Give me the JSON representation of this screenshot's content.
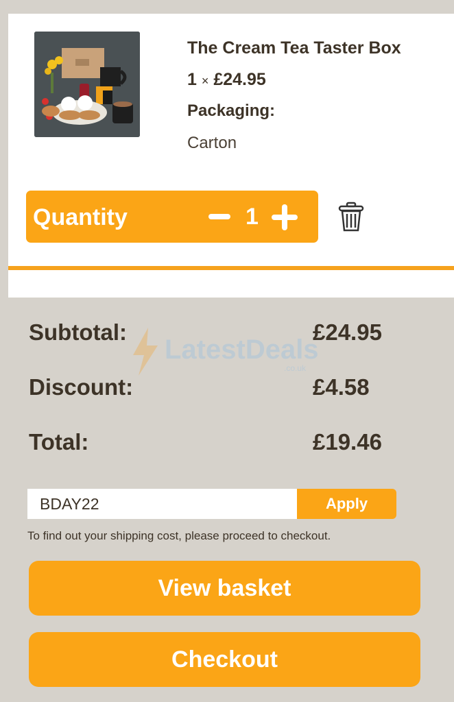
{
  "product": {
    "title": "The Cream Tea Taster Box",
    "quantity_prefix": "1",
    "multiply_sign": "×",
    "unit_price": "£24.95",
    "packaging_label": "Packaging:",
    "packaging_value": "Carton"
  },
  "quantity": {
    "label": "Quantity",
    "value": "1"
  },
  "summary": {
    "subtotal_label": "Subtotal:",
    "subtotal_value": "£24.95",
    "discount_label": "Discount:",
    "discount_value": "£4.58",
    "total_label": "Total:",
    "total_value": "£19.46"
  },
  "watermark": {
    "text": "LatestDeals",
    "sub": ".co.uk"
  },
  "coupon": {
    "value": "BDAY22",
    "apply_label": "Apply"
  },
  "shipping_note": "To find out your shipping cost, please proceed to checkout.",
  "buttons": {
    "view_basket": "View basket",
    "checkout": "Checkout"
  },
  "colors": {
    "accent": "#fba516",
    "text": "#3d3327",
    "background": "#d6d2cb"
  }
}
